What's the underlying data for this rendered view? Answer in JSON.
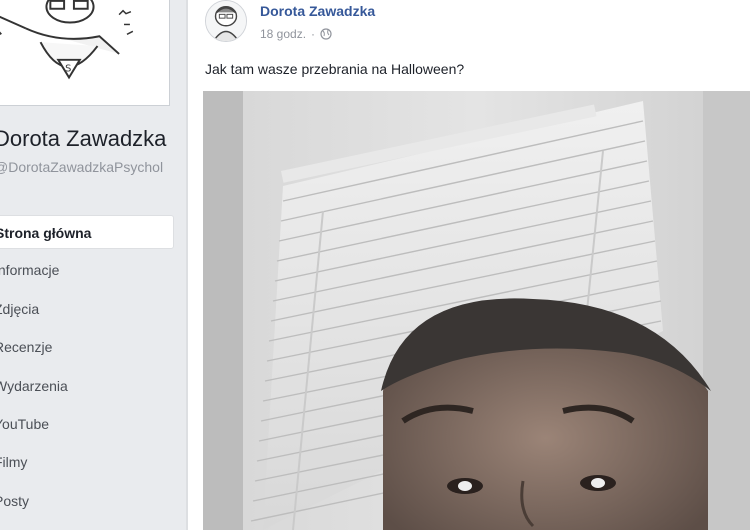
{
  "sidebar": {
    "page_name": "Dorota Zawadzka",
    "page_handle": "@DorotaZawadzkaPsychol",
    "nav_items": [
      {
        "label": "Strona główna",
        "active": true
      },
      {
        "label": "Informacje"
      },
      {
        "label": "Zdjęcia"
      },
      {
        "label": "Recenzje"
      },
      {
        "label": "Wydarzenia"
      },
      {
        "label": "YouTube"
      },
      {
        "label": "Filmy"
      },
      {
        "label": "Posty"
      }
    ]
  },
  "post": {
    "author": "Dorota Zawadzka",
    "time": "18 godz.",
    "separator": "·",
    "audience_icon": "globe-icon",
    "text": "Jak tam wasze przebrania na Halloween?"
  }
}
